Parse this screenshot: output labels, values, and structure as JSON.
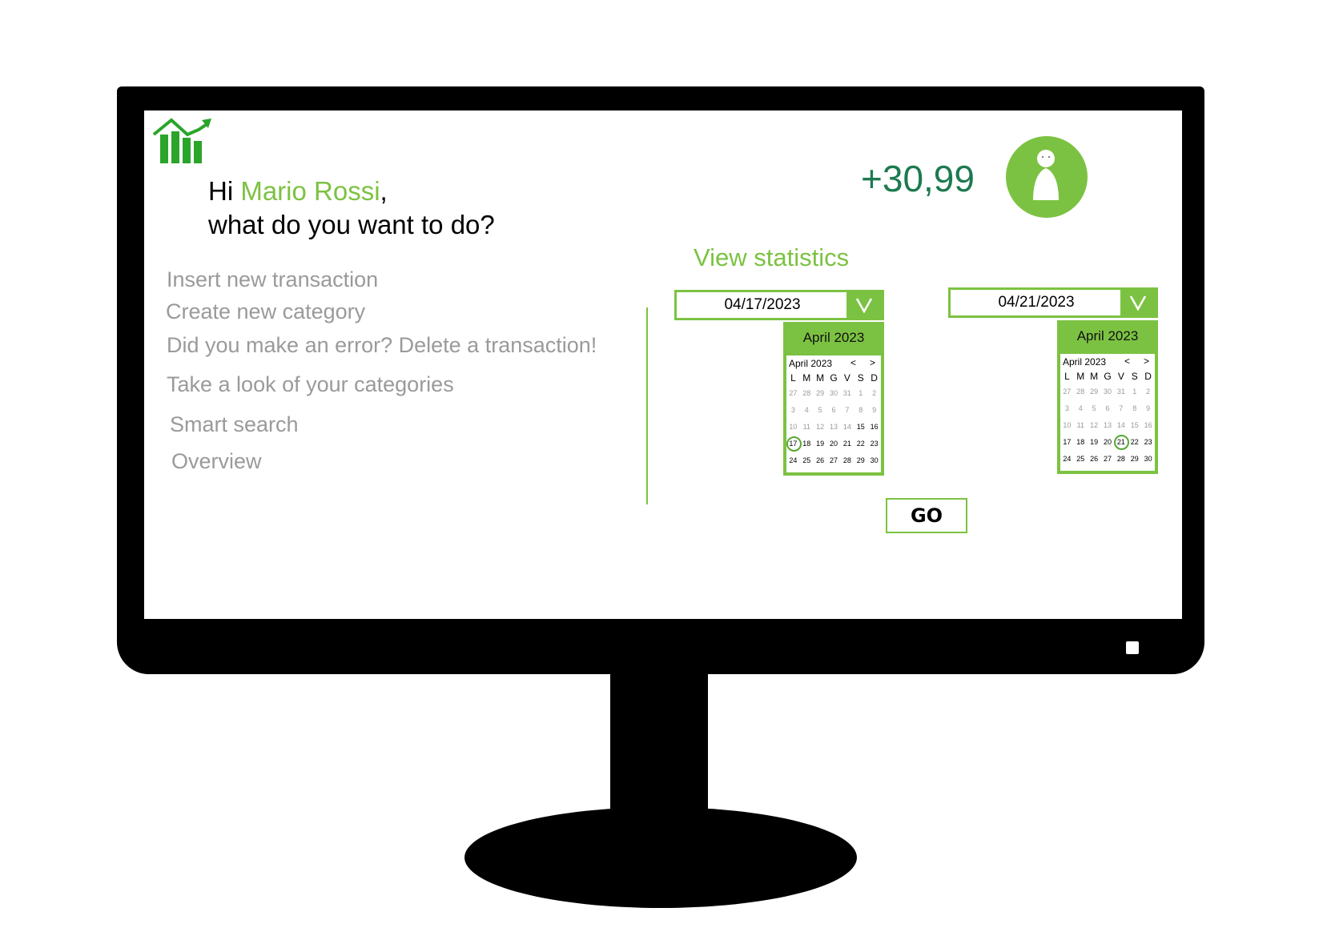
{
  "header": {
    "logo_icon": "bar-chart-growth-icon",
    "greeting_prefix": "Hi ",
    "user_name": "Mario Rossi",
    "greeting_suffix": ",",
    "greeting_question": "what do you want to do?",
    "balance": "+30,99",
    "avatar_icon": "user-avatar-icon"
  },
  "menu": {
    "items": [
      {
        "label": "Insert new transaction"
      },
      {
        "label": "Create new category"
      },
      {
        "label": "Did you make an error? Delete a transaction!"
      },
      {
        "label": "Take a look of your categories"
      },
      {
        "label": "Smart search"
      },
      {
        "label": "Overview"
      }
    ]
  },
  "statistics": {
    "title": "View statistics",
    "go_label": "GO",
    "start_date": {
      "value": "04/17/2023",
      "calendar_title": "April 2023",
      "month_label": "April 2023",
      "prev": "<",
      "next": ">",
      "selected_day": "17"
    },
    "end_date": {
      "value": "04/21/2023",
      "calendar_title": "April 2023",
      "month_label": "April 2023",
      "prev": "<",
      "next": ">",
      "selected_day": "21"
    },
    "weekdays": [
      "L",
      "M",
      "M",
      "G",
      "V",
      "S",
      "D"
    ],
    "days": [
      "27",
      "28",
      "29",
      "30",
      "31",
      "1",
      "2",
      "3",
      "4",
      "5",
      "6",
      "7",
      "8",
      "9",
      "10",
      "11",
      "12",
      "13",
      "14",
      "15",
      "16",
      "17",
      "18",
      "19",
      "20",
      "21",
      "22",
      "23",
      "24",
      "25",
      "26",
      "27",
      "28",
      "29",
      "30"
    ]
  },
  "colors": {
    "accent": "#7cc242",
    "balance": "#1d7a50",
    "menu_text": "#9a9a9a"
  }
}
